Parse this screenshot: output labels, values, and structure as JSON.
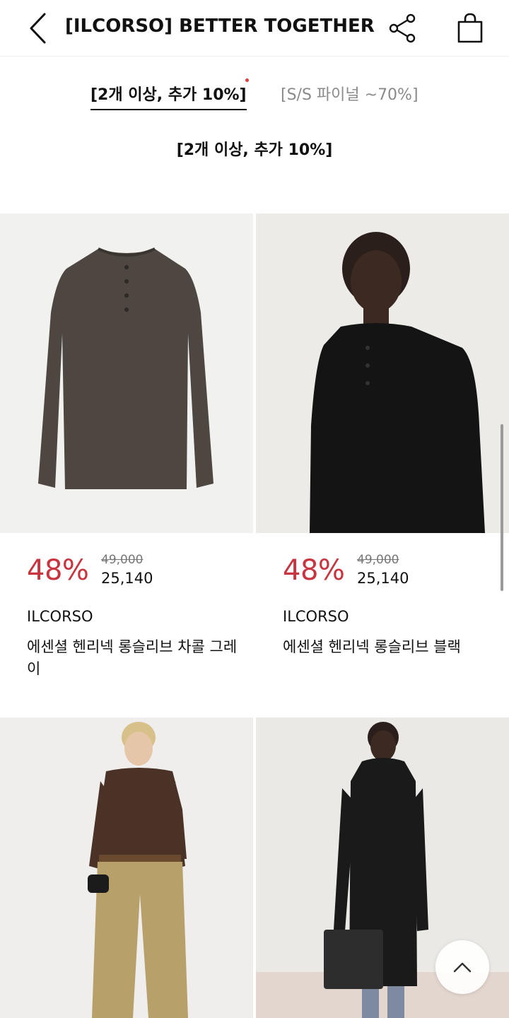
{
  "header": {
    "title": "[ILCORSO] BETTER TOGETHER",
    "back_icon": "chevron-left-icon",
    "share_icon": "share-icon",
    "bag_icon": "shopping-bag-icon"
  },
  "tabs": [
    {
      "label": "[2개 이상, 추가 10%]",
      "active": true
    },
    {
      "label": "[S/S 파이널 ~70%]",
      "active": false
    }
  ],
  "section": {
    "title": "[2개 이상, 추가 10%]"
  },
  "products": [
    {
      "discount": "48%",
      "original_price": "49,000",
      "sale_price": "25,140",
      "brand": "ILCORSO",
      "name": "에센셜 헨리넥 롱슬리브 차콜 그레이"
    },
    {
      "discount": "48%",
      "original_price": "49,000",
      "sale_price": "25,140",
      "brand": "ILCORSO",
      "name": "에센셜 헨리넥 롱슬리브 블랙"
    },
    {},
    {}
  ],
  "colors": {
    "discount": "#c8343f",
    "tab_dot": "#e23b3b",
    "inactive_tab": "#8a8a8a"
  },
  "scroll_top_icon": "chevron-up-icon"
}
